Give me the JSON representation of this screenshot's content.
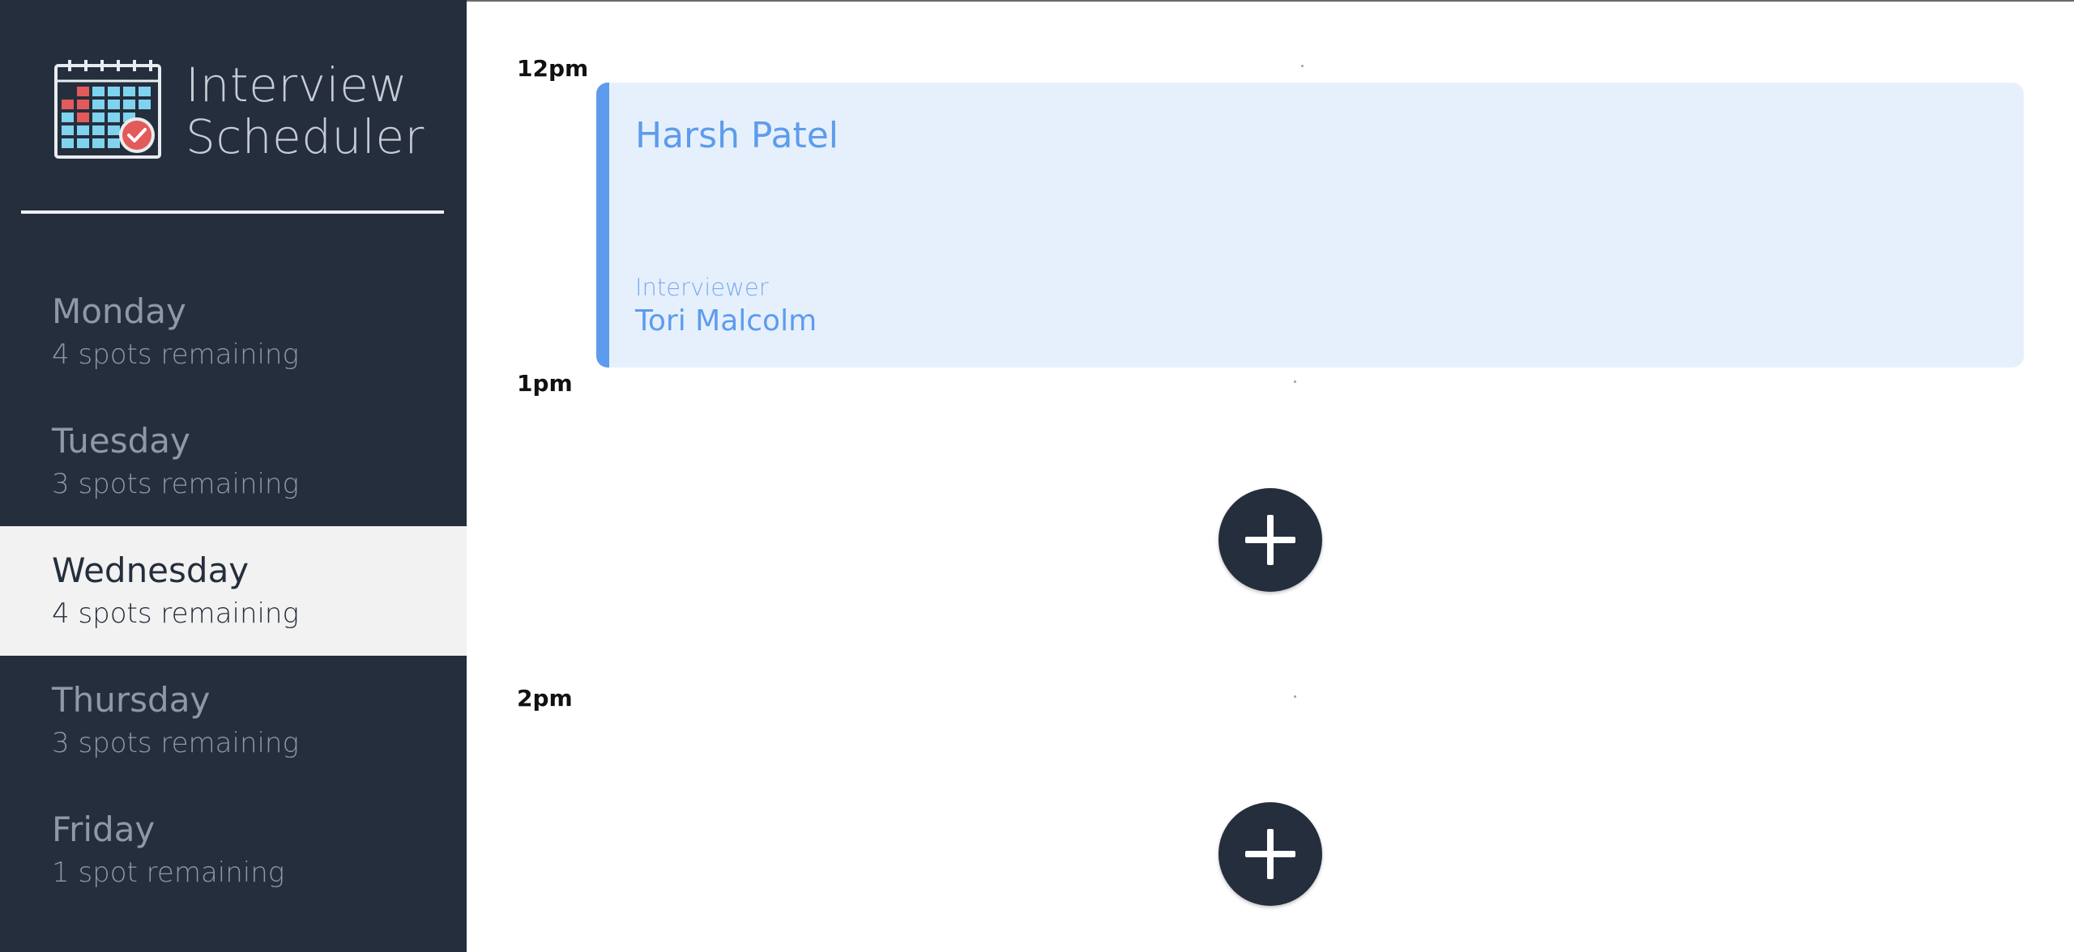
{
  "app": {
    "title_line1": "Interview",
    "title_line2": "Scheduler",
    "logo_icon": "calendar-check-icon"
  },
  "days": [
    {
      "name": "Monday",
      "spots": "4 spots remaining",
      "selected": false
    },
    {
      "name": "Tuesday",
      "spots": "3 spots remaining",
      "selected": false
    },
    {
      "name": "Wednesday",
      "spots": "4 spots remaining",
      "selected": true
    },
    {
      "name": "Thursday",
      "spots": "3 spots remaining",
      "selected": false
    },
    {
      "name": "Friday",
      "spots": "1 spot remaining",
      "selected": false
    }
  ],
  "schedule": {
    "times": [
      "12pm",
      "1pm",
      "2pm"
    ],
    "appointment": {
      "student": "Harsh Patel",
      "interviewer_label": "Interviewer",
      "interviewer_name": "Tori Malcolm"
    },
    "add_icon": "plus-icon"
  },
  "colors": {
    "sidebar_bg": "#252e3d",
    "selected_bg": "#f2f2f2",
    "accent": "#5d9cec",
    "appointment_bg": "#e6f0fd"
  }
}
